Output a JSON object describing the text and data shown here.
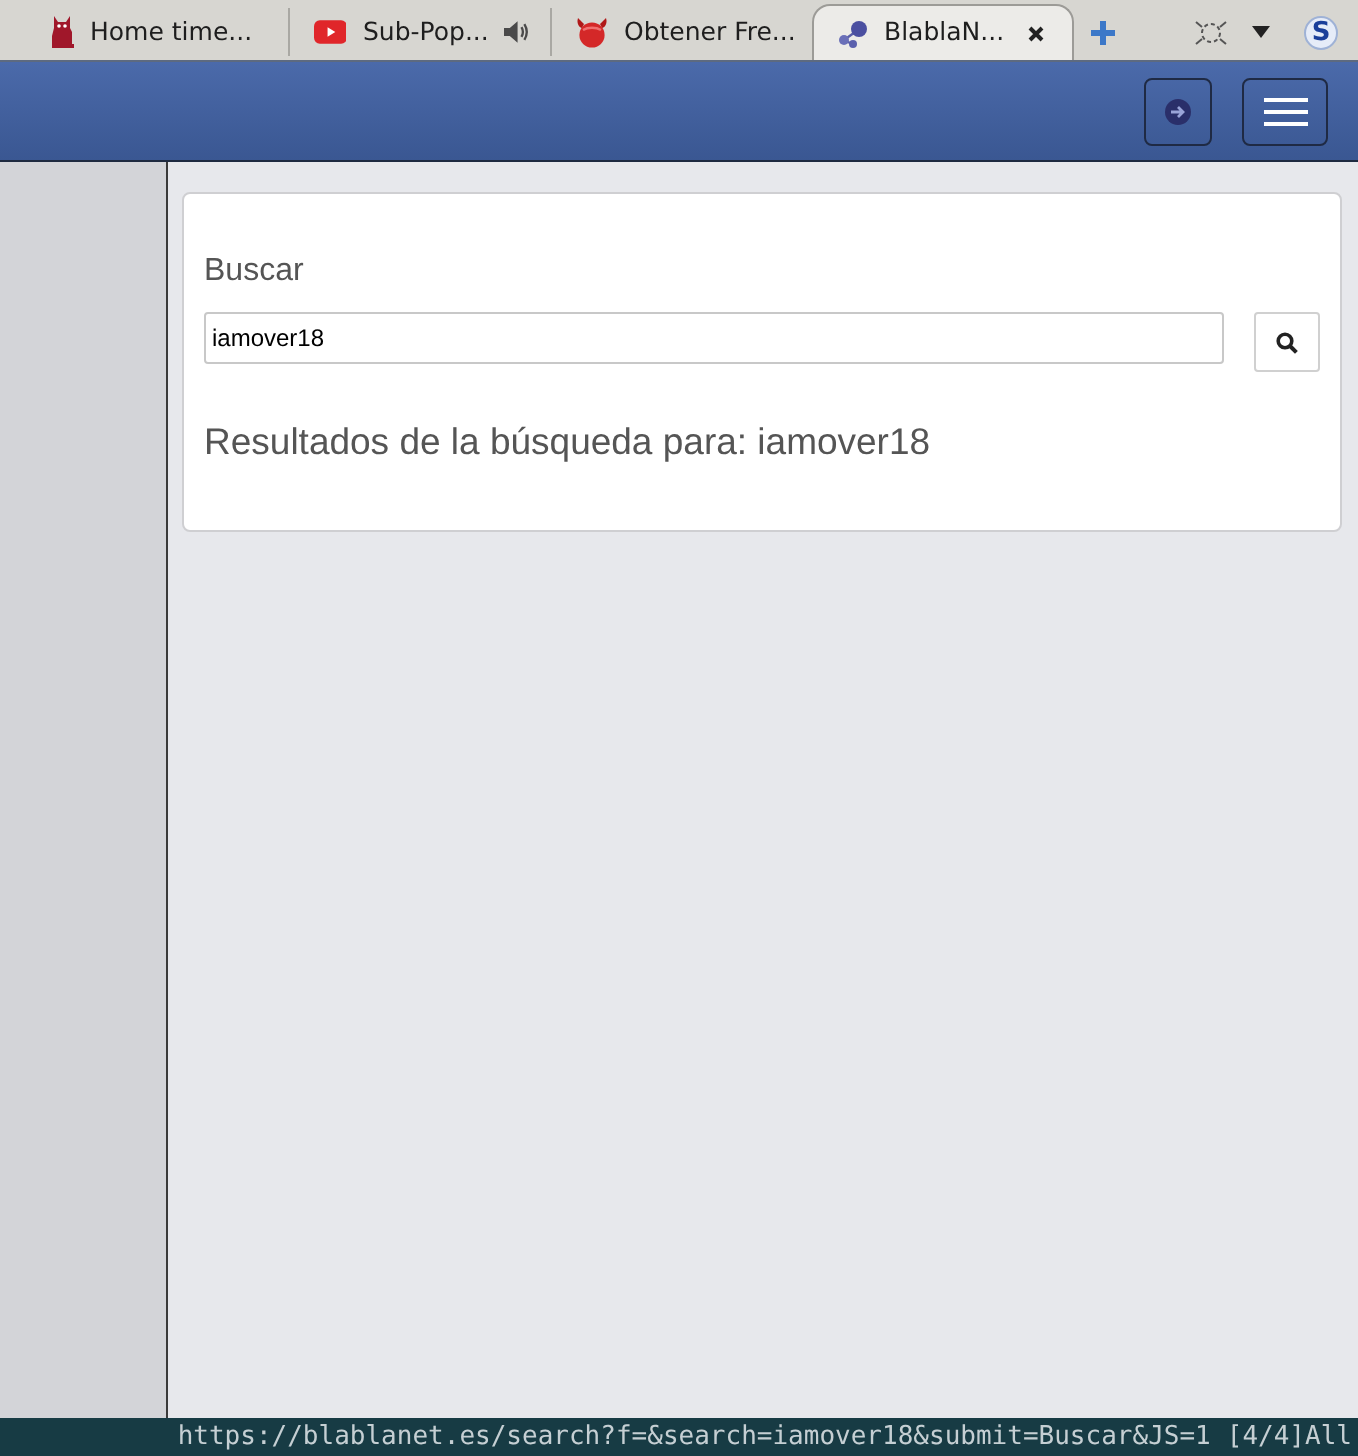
{
  "tabs": [
    {
      "label": "Home time...",
      "selected": false,
      "audio": false
    },
    {
      "label": "Sub-Pop...",
      "selected": false,
      "audio": true
    },
    {
      "label": "Obtener Fre...",
      "selected": false,
      "audio": false
    },
    {
      "label": "BlablaN...",
      "selected": true,
      "audio": false
    }
  ],
  "toolbar": {
    "profile_letter": "S"
  },
  "search_panel": {
    "label": "Buscar",
    "query": "iamover18",
    "results_heading": "Resultados de la búsqueda para: iamover18"
  },
  "status_bar": {
    "url": "https://blablanet.es/search?f=&search=iamover18&submit=Buscar&JS=1",
    "position": "[4/4]",
    "scroll": "All"
  }
}
